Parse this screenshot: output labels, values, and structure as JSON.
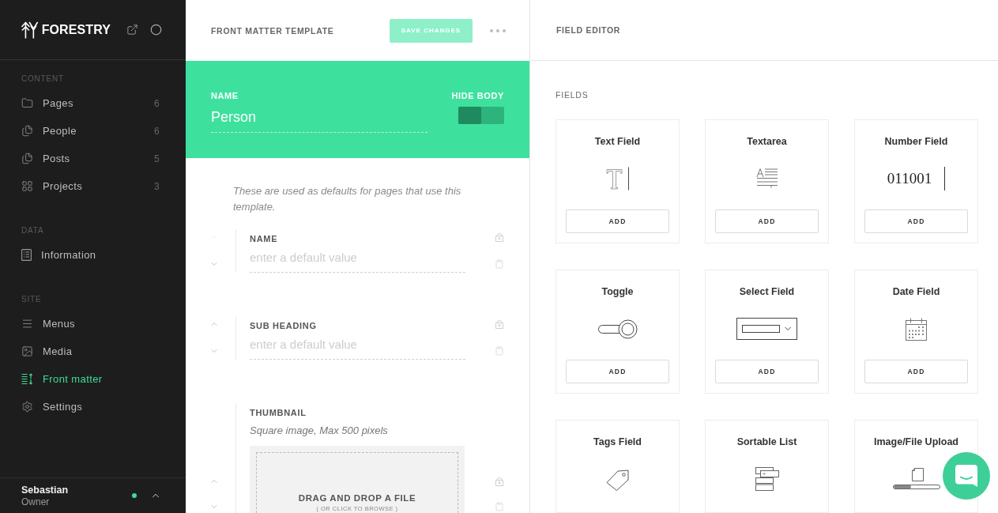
{
  "sidebar": {
    "brand": "FORESTRY",
    "sections": [
      {
        "title": "CONTENT",
        "items": [
          {
            "label": "Pages",
            "count": "6",
            "kind": "folder",
            "selected": false
          },
          {
            "label": "People",
            "count": "6",
            "kind": "documents",
            "selected": false
          },
          {
            "label": "Posts",
            "count": "5",
            "kind": "documents",
            "selected": false
          },
          {
            "label": "Projects",
            "count": "3",
            "kind": "grid",
            "selected": false
          }
        ]
      },
      {
        "title": "DATA",
        "items": [
          {
            "label": "Information",
            "kind": "list",
            "selected": false
          }
        ]
      },
      {
        "title": "SITE",
        "items": [
          {
            "label": "Menus",
            "kind": "menu",
            "selected": false
          },
          {
            "label": "Media",
            "kind": "image",
            "selected": false
          },
          {
            "label": "Front matter",
            "kind": "sort",
            "selected": true
          },
          {
            "label": "Settings",
            "kind": "gear",
            "selected": false
          }
        ]
      }
    ],
    "user": {
      "name": "Sebastian",
      "role": "Owner",
      "online": true
    }
  },
  "template_editor": {
    "title": "FRONT MATTER TEMPLATE",
    "save_button": {
      "label": "SAVE CHANGES",
      "disabled": true
    },
    "name": {
      "label": "NAME",
      "value": "Person"
    },
    "hide_body": {
      "label": "HIDE BODY",
      "on": false
    },
    "description": "These are used as defaults for pages that use this template.",
    "fields": [
      {
        "kind": "text",
        "label": "NAME",
        "placeholder": "enter a default value",
        "can_move_up": false
      },
      {
        "kind": "text",
        "label": "SUB HEADING",
        "placeholder": "enter a default value",
        "can_move_up": true
      },
      {
        "kind": "file",
        "label": "THUMBNAIL",
        "hint": "Square image, Max 500 pixels",
        "dropzone_title": "DRAG AND DROP A FILE",
        "dropzone_hint": "( OR CLICK TO BROWSE )",
        "can_move_up": true
      }
    ]
  },
  "field_editor": {
    "title": "FIELD EDITOR",
    "section": "FIELDS",
    "cards": [
      {
        "kind": "text",
        "title": "Text Field",
        "button": "ADD"
      },
      {
        "kind": "textarea",
        "title": "Textarea",
        "button": "ADD"
      },
      {
        "kind": "number",
        "title": "Number Field",
        "sample": "011001",
        "button": "ADD"
      },
      {
        "kind": "toggle",
        "title": "Toggle",
        "button": "ADD"
      },
      {
        "kind": "select",
        "title": "Select Field",
        "button": "ADD"
      },
      {
        "kind": "date",
        "title": "Date Field",
        "button": "ADD"
      },
      {
        "kind": "tags",
        "title": "Tags Field"
      },
      {
        "kind": "sortable",
        "title": "Sortable List"
      },
      {
        "kind": "upload",
        "title": "Image/File Upload"
      }
    ]
  }
}
